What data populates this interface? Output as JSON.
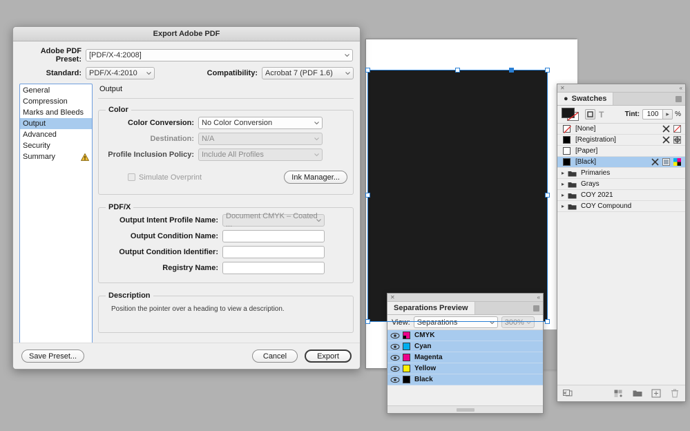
{
  "export_dialog": {
    "title": "Export Adobe PDF",
    "fields": {
      "preset_label": "Adobe PDF Preset:",
      "preset_value": "[PDF/X-4:2008]",
      "standard_label": "Standard:",
      "standard_value": "PDF/X-4:2010",
      "compatibility_label": "Compatibility:",
      "compatibility_value": "Acrobat 7 (PDF 1.6)"
    },
    "sidebar": [
      {
        "label": "General",
        "active": false,
        "warning": false
      },
      {
        "label": "Compression",
        "active": false,
        "warning": false
      },
      {
        "label": "Marks and Bleeds",
        "active": false,
        "warning": false
      },
      {
        "label": "Output",
        "active": true,
        "warning": false
      },
      {
        "label": "Advanced",
        "active": false,
        "warning": false
      },
      {
        "label": "Security",
        "active": false,
        "warning": false
      },
      {
        "label": "Summary",
        "active": false,
        "warning": true
      }
    ],
    "pane_title": "Output",
    "color_group": {
      "legend": "Color",
      "color_conversion_label": "Color Conversion:",
      "color_conversion_value": "No Color Conversion",
      "destination_label": "Destination:",
      "destination_value": "N/A",
      "profile_policy_label": "Profile Inclusion Policy:",
      "profile_policy_value": "Include All Profiles",
      "simulate_overprint_label": "Simulate Overprint",
      "ink_manager_label": "Ink Manager..."
    },
    "pdfx_group": {
      "legend": "PDF/X",
      "output_intent_label": "Output Intent Profile Name:",
      "output_intent_value": "Document CMYK – Coated ...",
      "condition_name_label": "Output Condition Name:",
      "condition_name_value": "",
      "condition_id_label": "Output Condition Identifier:",
      "condition_id_value": "",
      "registry_label": "Registry Name:",
      "registry_value": ""
    },
    "description_group": {
      "legend": "Description",
      "text": "Position the pointer over a heading to view a description."
    },
    "footer": {
      "save_preset_label": "Save Preset...",
      "cancel_label": "Cancel",
      "export_label": "Export"
    }
  },
  "separations_panel": {
    "tab_label": "Separations Preview",
    "view_label": "View:",
    "view_value": "Separations",
    "zoom_value": "300%",
    "rows": [
      {
        "name": "CMYK",
        "color": "cmyk",
        "visible": true
      },
      {
        "name": "Cyan",
        "color": "#00aeef",
        "visible": true
      },
      {
        "name": "Magenta",
        "color": "#ec008c",
        "visible": true
      },
      {
        "name": "Yellow",
        "color": "#fff200",
        "visible": true
      },
      {
        "name": "Black",
        "color": "#000000",
        "visible": true
      }
    ]
  },
  "swatches_panel": {
    "tab_label": "Swatches",
    "tint_label": "Tint:",
    "tint_value": "100",
    "tint_unit": "%",
    "formatting_text_icon": "T",
    "swatches": [
      {
        "name": "[None]",
        "chip": "none",
        "selected": false,
        "icons": [
          "lock-icon",
          "none-icon"
        ]
      },
      {
        "name": "[Registration]",
        "chip": "#000000",
        "selected": false,
        "icons": [
          "lock-icon",
          "registration-icon"
        ]
      },
      {
        "name": "[Paper]",
        "chip": "#ffffff",
        "selected": false,
        "icons": []
      },
      {
        "name": "[Black]",
        "chip": "#000000",
        "selected": true,
        "icons": [
          "lock-icon",
          "process-icon",
          "cmyk-icon"
        ]
      }
    ],
    "groups": [
      {
        "name": "Primaries"
      },
      {
        "name": "Grays"
      },
      {
        "name": "COY 2021"
      },
      {
        "name": "COY Compound"
      }
    ],
    "footer_icons": [
      "add-to-library-icon",
      "new-color-group-icon",
      "new-folder-icon",
      "new-swatch-icon",
      "delete-swatch-icon"
    ]
  },
  "colors": {
    "selection_blue": "#a8cbee",
    "accent_border": "#6f9ede",
    "panel_bg": "#efefef",
    "desktop_bg": "#b2b2b2",
    "artwork_black": "#1c1c1c"
  }
}
